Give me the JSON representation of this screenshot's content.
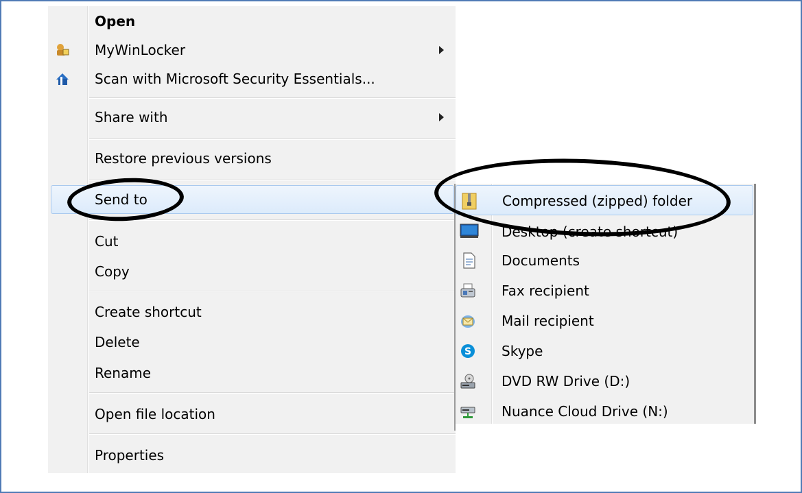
{
  "context_menu": {
    "items": [
      {
        "label": "Open",
        "bold": true
      },
      {
        "label": "MyWinLocker",
        "icon": "lock-user-icon",
        "submenu": true
      },
      {
        "label": "Scan with Microsoft Security Essentials...",
        "icon": "security-shield-icon"
      },
      {
        "label": "Share with",
        "submenu": true
      },
      {
        "label": "Restore previous versions"
      },
      {
        "label": "Send to",
        "submenu": true,
        "highlighted": true
      },
      {
        "label": "Cut"
      },
      {
        "label": "Copy"
      },
      {
        "label": "Create shortcut"
      },
      {
        "label": "Delete"
      },
      {
        "label": "Rename"
      },
      {
        "label": "Open file location"
      },
      {
        "label": "Properties"
      }
    ]
  },
  "send_to_submenu": {
    "items": [
      {
        "label": "Compressed (zipped) folder",
        "icon": "zip-folder-icon",
        "highlighted": true
      },
      {
        "label": "Desktop (create shortcut)",
        "icon": "desktop-icon"
      },
      {
        "label": "Documents",
        "icon": "document-icon"
      },
      {
        "label": "Fax recipient",
        "icon": "fax-icon"
      },
      {
        "label": "Mail recipient",
        "icon": "mail-icon"
      },
      {
        "label": "Skype",
        "icon": "skype-icon"
      },
      {
        "label": "DVD RW Drive (D:)",
        "icon": "dvd-drive-icon"
      },
      {
        "label": "Nuance Cloud Drive (N:)",
        "icon": "network-drive-icon"
      }
    ]
  },
  "colors": {
    "border": "#4f7bb5",
    "menu_bg": "#f1f1f1",
    "highlight_border": "#a9c9ee",
    "annotation": "#000000"
  }
}
